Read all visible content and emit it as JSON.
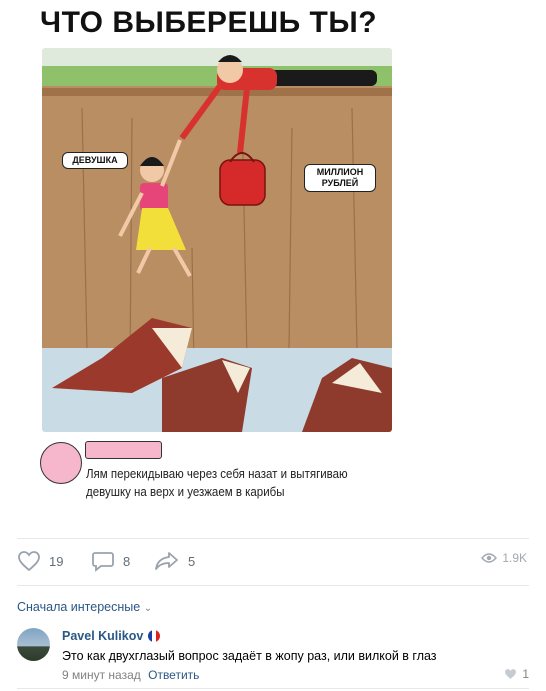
{
  "meme": {
    "title": "ЧТО ВЫБЕРЕШЬ ТЫ?",
    "label_girl": "ДЕВУШКА",
    "label_money": "МИЛЛИОН РУБЛЕЙ",
    "reply_text": "Лям перекидываю через себя назат и вытягиваю девушку на верх и уезжаем в карибы"
  },
  "post_actions": {
    "likes": "19",
    "comments": "8",
    "shares": "5",
    "views": "1.9K"
  },
  "comments": {
    "sort_label": "Сначала интересные",
    "items": [
      {
        "author": "Pavel Kulikov",
        "text": "Это как двухглазый вопрос задаёт в жопу раз, или вилкой в глаз",
        "time": "9 минут назад",
        "reply_label": "Ответить",
        "likes": "1"
      }
    ]
  }
}
